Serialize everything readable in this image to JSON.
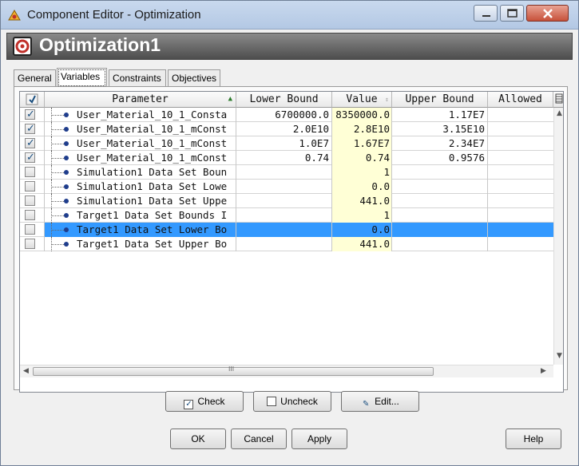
{
  "window": {
    "title": "Component Editor - Optimization"
  },
  "component": {
    "name": "Optimization1"
  },
  "tabs": [
    {
      "label": "General"
    },
    {
      "label": "Variables"
    },
    {
      "label": "Constraints"
    },
    {
      "label": "Objectives"
    }
  ],
  "active_tab": "Variables",
  "grid": {
    "columns": {
      "parameter": "Parameter",
      "lower": "Lower Bound",
      "value": "Value",
      "upper": "Upper Bound",
      "allowed": "Allowed"
    },
    "rows": [
      {
        "checked": true,
        "parameter": "User_Material_10_1_Consta",
        "lower": "6700000.0",
        "value": "8350000.0",
        "upper": "1.17E7"
      },
      {
        "checked": true,
        "parameter": "User_Material_10_1_mConst",
        "lower": "2.0E10",
        "value": "2.8E10",
        "upper": "3.15E10"
      },
      {
        "checked": true,
        "parameter": "User_Material_10_1_mConst",
        "lower": "1.0E7",
        "value": "1.67E7",
        "upper": "2.34E7"
      },
      {
        "checked": true,
        "parameter": "User_Material_10_1_mConst",
        "lower": "0.74",
        "value": "0.74",
        "upper": "0.9576"
      },
      {
        "checked": false,
        "parameter": "Simulation1 Data Set Boun",
        "lower": "",
        "value": "1",
        "upper": ""
      },
      {
        "checked": false,
        "parameter": "Simulation1 Data Set Lowe",
        "lower": "",
        "value": "0.0",
        "upper": ""
      },
      {
        "checked": false,
        "parameter": "Simulation1 Data Set Uppe",
        "lower": "",
        "value": "441.0",
        "upper": ""
      },
      {
        "checked": false,
        "parameter": "Target1 Data Set Bounds I",
        "lower": "",
        "value": "1",
        "upper": ""
      },
      {
        "checked": false,
        "parameter": "Target1 Data Set Lower Bo",
        "lower": "",
        "value": "0.0",
        "upper": "",
        "selected": true
      },
      {
        "checked": false,
        "parameter": "Target1 Data Set Upper Bo",
        "lower": "",
        "value": "441.0",
        "upper": ""
      }
    ]
  },
  "actions": {
    "check": "Check",
    "uncheck": "Uncheck",
    "edit": "Edit..."
  },
  "dialog": {
    "ok": "OK",
    "cancel": "Cancel",
    "apply": "Apply",
    "help": "Help"
  },
  "hscroll_grip": "III"
}
